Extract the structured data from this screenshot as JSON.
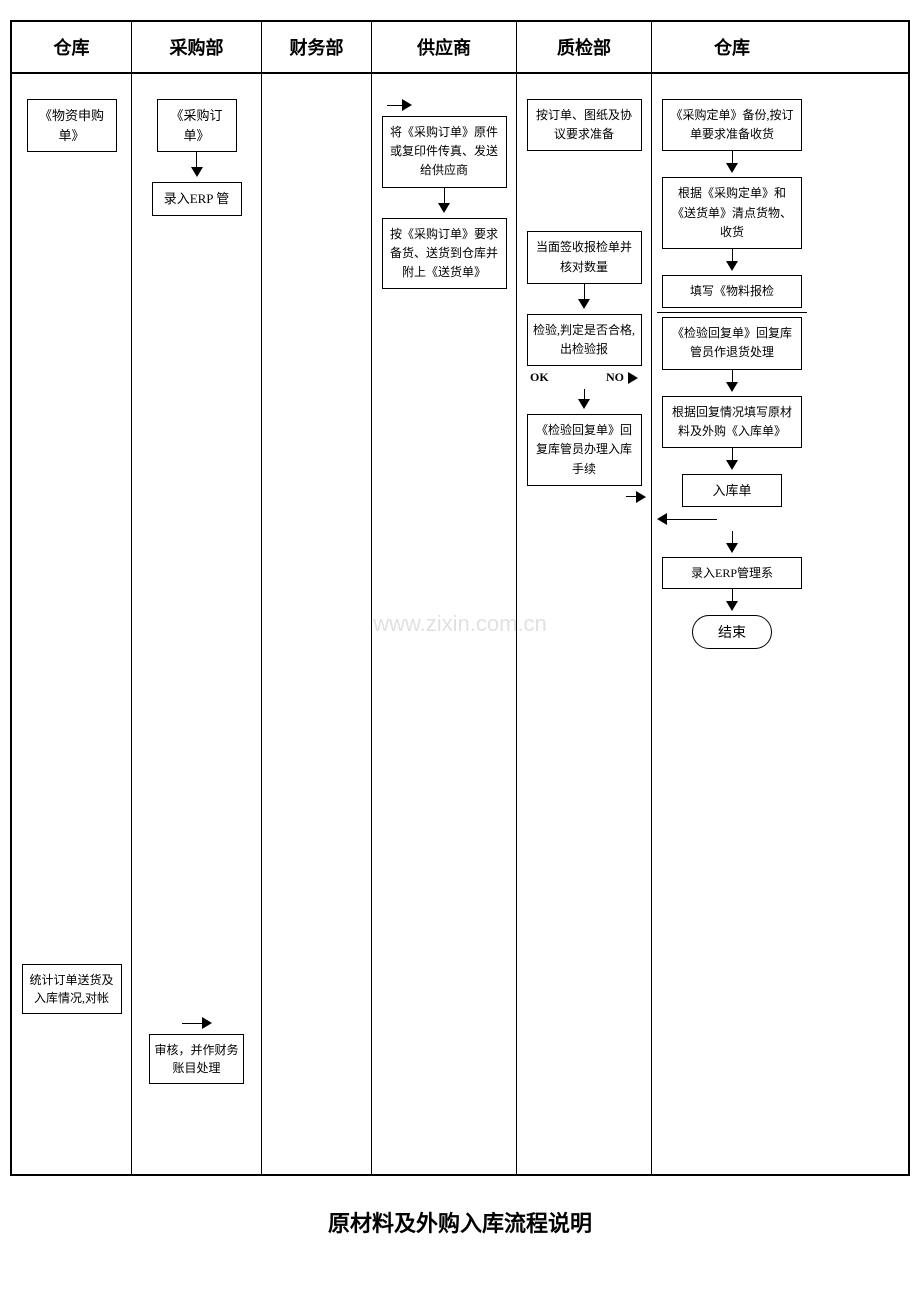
{
  "header": {
    "col1": "仓库",
    "col2": "采购部",
    "col3": "财务部",
    "col4": "供应商",
    "col5": "质检部",
    "col6": "仓库"
  },
  "footer": {
    "title": "原材料及外购入库流程说明"
  },
  "watermark": "www.zixin.com.cn",
  "col1": {
    "box1": "《物资申购单》",
    "box2": "统计订单送货及入库情况,对帐"
  },
  "col2": {
    "box1": "《采购订单》",
    "box2": "录入ERP 管",
    "box3": "审核，并作财务账目处理"
  },
  "col3": {},
  "col4": {
    "box1": "将《采购订单》原件或复印件传真、发送给供应商",
    "box2": "按《采购订单》要求备货、送货到仓库并附上《送货单》"
  },
  "col5": {
    "box1": "按订单、图纸及协议要求准备",
    "box2": "当面签收报检单并核对数量",
    "box3": "检验,判定是否合格,出检验报",
    "label_no": "NO",
    "label_ok": "OK",
    "box4": "《检验回复单》回复库管员办理入库手续"
  },
  "col6": {
    "box1": "《采购定单》备份,按订单要求准备收货",
    "box2": "根据《采购定单》和《送货单》清点货物、收货",
    "box3": "填写《物料报检",
    "box4": "《检验回复单》回复库管员作退货处理",
    "box5": "根据回复情况填写原材料及外购《入库单》",
    "box6": "入库单",
    "box7": "录入ERP管理系",
    "box8": "结束"
  }
}
